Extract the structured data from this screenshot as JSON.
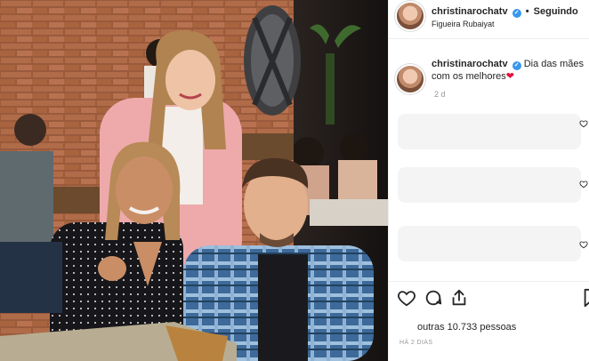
{
  "post": {
    "username": "christinarochatv",
    "verified_badge": "✓",
    "follow_separator": "•",
    "follow_status": "Seguindo",
    "location": "Figueira Rubaiyat"
  },
  "caption": {
    "username": "christinarochatv",
    "text": "Dia das mães com os melhores",
    "emoji": "❤",
    "time_ago": "2 d"
  },
  "actions": {
    "like_icon": "heart-icon",
    "comment_icon": "comment-icon",
    "share_icon": "share-icon"
  },
  "likes": {
    "text": "outras 10.733 pessoas"
  },
  "timestamp": "HÁ 2 DIAS",
  "colors": {
    "verified": "#3897f0",
    "heart_emoji": "#e0123a",
    "muted_text": "#999999",
    "border": "#efefef"
  }
}
